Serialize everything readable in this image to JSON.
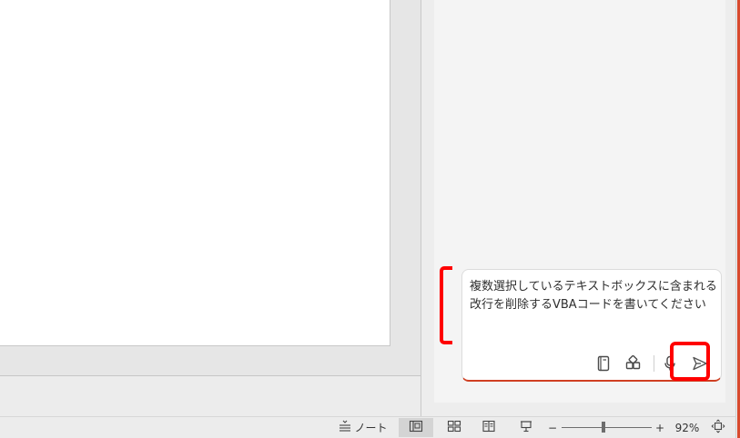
{
  "copilot": {
    "prompt_text": "複数選択しているテキストボックスに含まれる改行を削除するVBAコードを書いてください",
    "tools": [
      {
        "name": "notebook-icon"
      },
      {
        "name": "apps-icon"
      },
      {
        "name": "microphone-icon"
      },
      {
        "name": "send-icon"
      }
    ]
  },
  "status_bar": {
    "notes_label": "ノート",
    "view_normal_icon": "normal-view-icon",
    "view_sorter_icon": "slide-sorter-icon",
    "view_reading_icon": "reading-view-icon",
    "view_slideshow_icon": "slide-show-icon",
    "zoom_minus": "−",
    "zoom_plus": "+",
    "zoom_percent": "92%",
    "zoom_value": 92,
    "fit_icon": "fit-slide-icon"
  },
  "highlight": {
    "color": "#ff0000"
  },
  "theme": {
    "accent": "#cf3f22"
  }
}
